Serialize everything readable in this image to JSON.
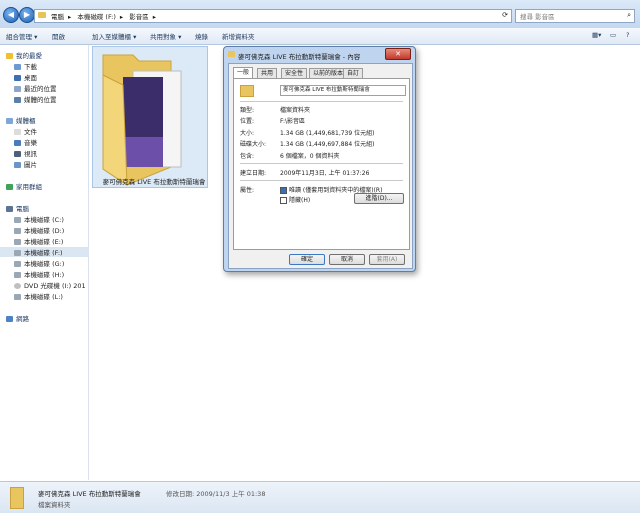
{
  "address_bar": {
    "crumbs": [
      "電腦",
      "本機磁碟 (F:)",
      "影音區"
    ],
    "search_placeholder": "搜尋 影音區"
  },
  "toolbar": {
    "organize": "組合管理 ▾",
    "open": "開啟",
    "include_in_library": "加入至媒體櫃 ▾",
    "share_with": "共用對象 ▾",
    "burn": "燒錄",
    "new_folder": "新增資料夾"
  },
  "sidebar": {
    "favorites": "我的最愛",
    "favorites_items": [
      "下載",
      "桌面",
      "最近的位置",
      "媒體的位置"
    ],
    "libraries": "媒體櫃",
    "libraries_items": [
      "文件",
      "音樂",
      "視訊",
      "圖片"
    ],
    "homegroup": "家用群組",
    "computer": "電腦",
    "drives": [
      "本機磁碟 (C:)",
      "本機磁碟 (D:)",
      "本機磁碟 (E:)",
      "本機磁碟 (F:)",
      "本機磁碟 (G:)",
      "本機磁碟 (H:)",
      "DVD 光碟機 (I:) 201",
      "本機磁碟 (L:)"
    ],
    "network": "網路"
  },
  "folder": {
    "name": "麥可佛克森 LIVE 布拉動斯特蘭瑞會"
  },
  "status": {
    "name": "麥可佛克森 LIVE 布拉動斯特蘭瑞會",
    "modified": "修改日期: 2009/11/3 上午 01:38",
    "type": "檔案資料夾"
  },
  "dialog": {
    "title": "麥可佛克森 LIVE 布拉動斯特蘭瑞會 - 內容",
    "close": "✕",
    "tabs": [
      "一般",
      "共用",
      "安全性",
      "以前的版本",
      "自訂"
    ],
    "name_value": "麥可佛克森 LIVE 布拉動斯特蘭瑞會",
    "rows": [
      {
        "label": "類型:",
        "value": "檔案資料夾"
      },
      {
        "label": "位置:",
        "value": "F:\\影音區"
      },
      {
        "label": "大小:",
        "value": "1.34 GB (1,449,681,739 位元組)"
      },
      {
        "label": "磁碟大小:",
        "value": "1.34 GB (1,449,697,884 位元組)"
      },
      {
        "label": "包含:",
        "value": "6 個檔案，0 個資料夾"
      },
      {
        "label": "建立日期:",
        "value": "2009年11月3日, 上午 01:37:26"
      }
    ],
    "attributes_label": "屬性:",
    "readonly_label": "唯讀 (僅套用到資料夾中的檔案)(R)",
    "hidden_label": "隱藏(H)",
    "advanced": "進階(D)...",
    "ok": "確定",
    "cancel": "取消",
    "apply": "套用(A)"
  }
}
